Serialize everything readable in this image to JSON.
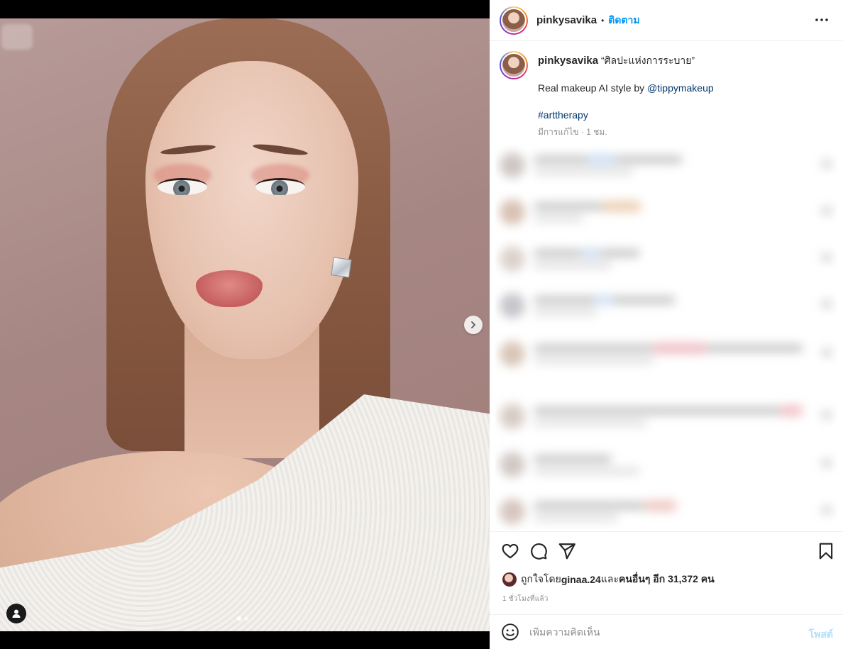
{
  "post": {
    "username": "pinkysavika",
    "header_separator": "•",
    "follow_label": "ติดตาม",
    "caption": {
      "username": "pinkysavika",
      "title": "“ศิลปะแห่งการระบาย”",
      "line2_text": "Real makeup AI style by ",
      "mention": "@tippymakeup",
      "hashtag": "#arttherapy",
      "meta": "มีการแก้ไข · 1 ชม."
    },
    "likes": {
      "prefix": "ถูกใจโดย ",
      "user": "ginaa.24",
      "mid": " และ",
      "others": "คนอื่นๆ อีก 31,372 คน"
    },
    "time_ago": "1 ชั่วโมงที่แล้ว",
    "comment_box": {
      "placeholder": "เพิ่มความคิดเห็น",
      "post_label": "โพสต์"
    },
    "carousel": {
      "total": 2,
      "current": 1
    }
  },
  "icons": {
    "more": "more-horizontal-icon",
    "like": "heart-icon",
    "comment": "comment-bubble-icon",
    "share": "paper-plane-icon",
    "save": "bookmark-icon",
    "emoji": "smiley-icon",
    "next": "chevron-right-icon",
    "tags": "user-tag-icon"
  },
  "colors": {
    "link": "#00376b",
    "follow": "#0095f6",
    "post_disabled": "#b2dffc",
    "muted": "#8e8e8e"
  }
}
